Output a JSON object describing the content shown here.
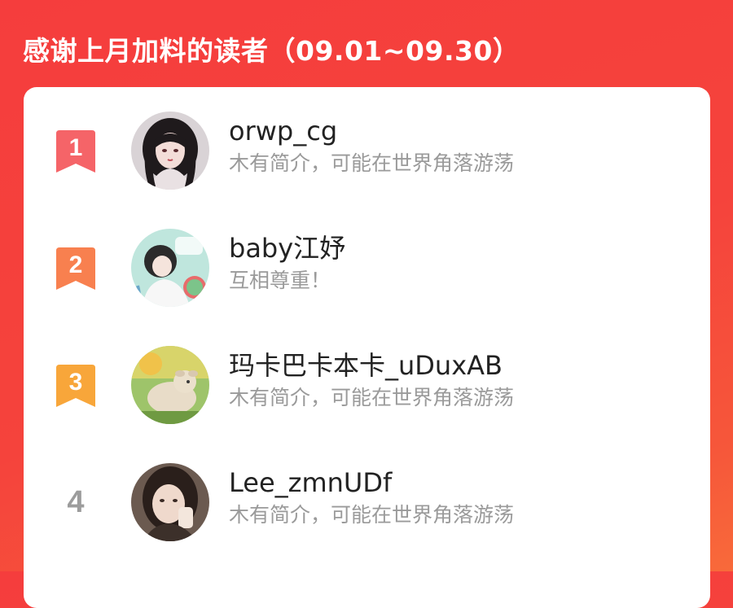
{
  "header": {
    "title": "感谢上月加料的读者（09.01~09.30）"
  },
  "colors": {
    "background": "#f5433c",
    "card": "#ffffff",
    "rank1": "#f56468",
    "rank2": "#f8804f",
    "rank3": "#f8a63a",
    "rank_plain": "#9c9c9c"
  },
  "readers": [
    {
      "rank": "1",
      "name": "orwp_cg",
      "bio": "木有简介，可能在世界角落游荡"
    },
    {
      "rank": "2",
      "name": "baby江妤",
      "bio": "互相尊重！"
    },
    {
      "rank": "3",
      "name": "玛卡巴卡本卡_uDuxAB",
      "bio": "木有简介，可能在世界角落游荡"
    },
    {
      "rank": "4",
      "name": "Lee_zmnUDf",
      "bio": "木有简介，可能在世界角落游荡"
    }
  ]
}
